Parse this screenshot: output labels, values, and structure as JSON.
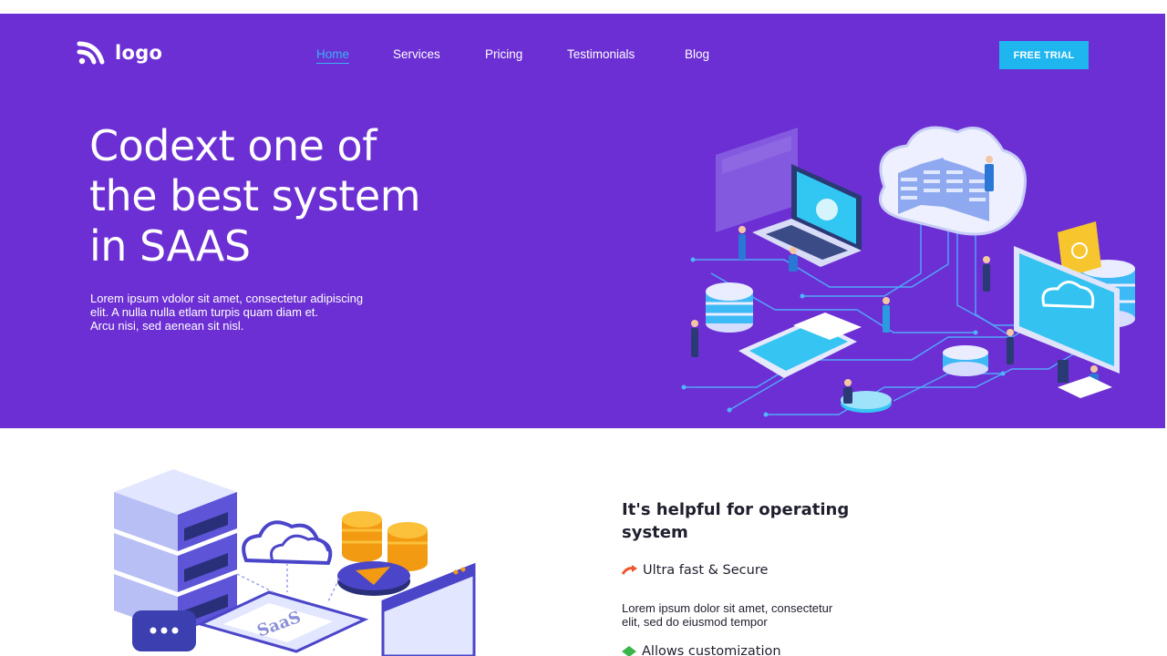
{
  "header": {
    "logo_text": "logo",
    "nav": [
      {
        "label": "Home",
        "active": true
      },
      {
        "label": "Services",
        "active": false
      },
      {
        "label": "Pricing",
        "active": false
      },
      {
        "label": "Testimonials",
        "active": false
      },
      {
        "label": "Blog",
        "active": false
      }
    ],
    "cta_label": "FREE TRIAL"
  },
  "hero": {
    "title_lines": [
      "Codext one of",
      "the best system",
      "in SAAS"
    ],
    "body_lines": [
      "Lorem ipsum vdolor sit amet, consectetur adipiscing",
      "elit. A nulla nulla etlam turpis quam diam et.",
      "Arcu nisi, sed aenean sit nisl."
    ]
  },
  "features_section": {
    "title_lines": [
      "It's helpful for operating",
      "system"
    ],
    "features": [
      {
        "label": "Ultra fast & Secure",
        "icon": "arrow-icon",
        "color": "#f0562d"
      },
      {
        "label": "Allows customization",
        "icon": "diamond-icon",
        "color": "#3ab54a"
      }
    ],
    "body_lines": [
      "Lorem ipsum dolor sit amet, consectetur",
      "elit, sed do eiusmod tempor"
    ],
    "illustration_label": "SaaS"
  },
  "colors": {
    "hero_bg": "#6c2fd3",
    "accent": "#1fb6f0",
    "nav_active": "#37b2f5",
    "text_dark": "#1f1f2e"
  }
}
